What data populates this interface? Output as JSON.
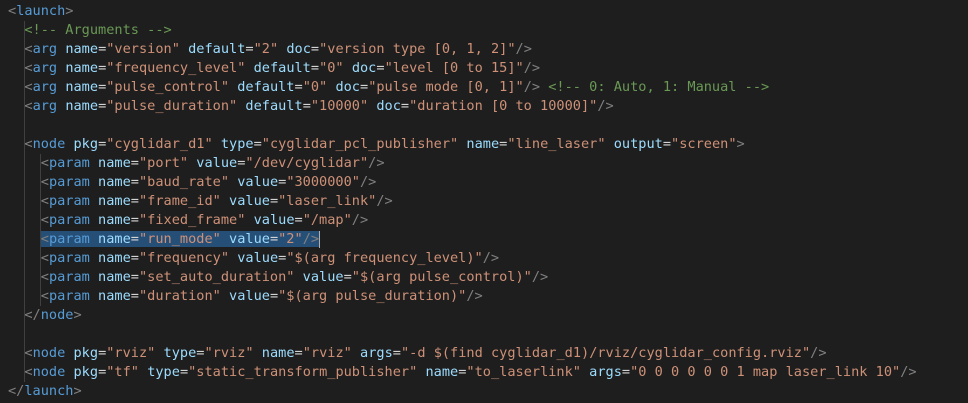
{
  "lines": [
    {
      "indent": 0,
      "tokens": [
        [
          "p",
          "<"
        ],
        [
          "t",
          "launch"
        ],
        [
          "p",
          ">"
        ]
      ]
    },
    {
      "indent": 1,
      "tokens": [
        [
          "c",
          "<!-- Arguments -->"
        ]
      ]
    },
    {
      "indent": 1,
      "tokens": [
        [
          "p",
          "<"
        ],
        [
          "t",
          "arg"
        ],
        [
          "s",
          " "
        ],
        [
          "a",
          "name"
        ],
        [
          "e",
          "="
        ],
        [
          "v",
          "\"version\""
        ],
        [
          "s",
          " "
        ],
        [
          "a",
          "default"
        ],
        [
          "e",
          "="
        ],
        [
          "v",
          "\"2\""
        ],
        [
          "s",
          " "
        ],
        [
          "a",
          "doc"
        ],
        [
          "e",
          "="
        ],
        [
          "v",
          "\"version type [0, 1, 2]\""
        ],
        [
          "p",
          "/>"
        ]
      ]
    },
    {
      "indent": 1,
      "tokens": [
        [
          "p",
          "<"
        ],
        [
          "t",
          "arg"
        ],
        [
          "s",
          " "
        ],
        [
          "a",
          "name"
        ],
        [
          "e",
          "="
        ],
        [
          "v",
          "\"frequency_level\""
        ],
        [
          "s",
          " "
        ],
        [
          "a",
          "default"
        ],
        [
          "e",
          "="
        ],
        [
          "v",
          "\"0\""
        ],
        [
          "s",
          " "
        ],
        [
          "a",
          "doc"
        ],
        [
          "e",
          "="
        ],
        [
          "v",
          "\"level [0 to 15]\""
        ],
        [
          "p",
          "/>"
        ]
      ]
    },
    {
      "indent": 1,
      "tokens": [
        [
          "p",
          "<"
        ],
        [
          "t",
          "arg"
        ],
        [
          "s",
          " "
        ],
        [
          "a",
          "name"
        ],
        [
          "e",
          "="
        ],
        [
          "v",
          "\"pulse_control\""
        ],
        [
          "s",
          " "
        ],
        [
          "a",
          "default"
        ],
        [
          "e",
          "="
        ],
        [
          "v",
          "\"0\""
        ],
        [
          "s",
          " "
        ],
        [
          "a",
          "doc"
        ],
        [
          "e",
          "="
        ],
        [
          "v",
          "\"pulse mode [0, 1]\""
        ],
        [
          "p",
          "/>"
        ],
        [
          "s",
          " "
        ],
        [
          "c",
          "<!-- 0: Auto, 1: Manual -->"
        ]
      ]
    },
    {
      "indent": 1,
      "tokens": [
        [
          "p",
          "<"
        ],
        [
          "t",
          "arg"
        ],
        [
          "s",
          " "
        ],
        [
          "a",
          "name"
        ],
        [
          "e",
          "="
        ],
        [
          "v",
          "\"pulse_duration\""
        ],
        [
          "s",
          " "
        ],
        [
          "a",
          "default"
        ],
        [
          "e",
          "="
        ],
        [
          "v",
          "\"10000\""
        ],
        [
          "s",
          " "
        ],
        [
          "a",
          "doc"
        ],
        [
          "e",
          "="
        ],
        [
          "v",
          "\"duration [0 to 10000]\""
        ],
        [
          "p",
          "/>"
        ]
      ]
    },
    {
      "indent": 1,
      "tokens": []
    },
    {
      "indent": 1,
      "tokens": [
        [
          "p",
          "<"
        ],
        [
          "t",
          "node"
        ],
        [
          "s",
          " "
        ],
        [
          "a",
          "pkg"
        ],
        [
          "e",
          "="
        ],
        [
          "v",
          "\"cyglidar_d1\""
        ],
        [
          "s",
          " "
        ],
        [
          "a",
          "type"
        ],
        [
          "e",
          "="
        ],
        [
          "v",
          "\"cyglidar_pcl_publisher\""
        ],
        [
          "s",
          " "
        ],
        [
          "a",
          "name"
        ],
        [
          "e",
          "="
        ],
        [
          "v",
          "\"line_laser\""
        ],
        [
          "s",
          " "
        ],
        [
          "a",
          "output"
        ],
        [
          "e",
          "="
        ],
        [
          "v",
          "\"screen\""
        ],
        [
          "p",
          ">"
        ]
      ]
    },
    {
      "indent": 2,
      "tokens": [
        [
          "p",
          "<"
        ],
        [
          "t",
          "param"
        ],
        [
          "s",
          " "
        ],
        [
          "a",
          "name"
        ],
        [
          "e",
          "="
        ],
        [
          "v",
          "\"port\""
        ],
        [
          "s",
          " "
        ],
        [
          "a",
          "value"
        ],
        [
          "e",
          "="
        ],
        [
          "v",
          "\"/dev/cyglidar\""
        ],
        [
          "p",
          "/>"
        ]
      ]
    },
    {
      "indent": 2,
      "tokens": [
        [
          "p",
          "<"
        ],
        [
          "t",
          "param"
        ],
        [
          "s",
          " "
        ],
        [
          "a",
          "name"
        ],
        [
          "e",
          "="
        ],
        [
          "v",
          "\"baud_rate\""
        ],
        [
          "s",
          " "
        ],
        [
          "a",
          "value"
        ],
        [
          "e",
          "="
        ],
        [
          "v",
          "\"3000000\""
        ],
        [
          "p",
          "/>"
        ]
      ]
    },
    {
      "indent": 2,
      "tokens": [
        [
          "p",
          "<"
        ],
        [
          "t",
          "param"
        ],
        [
          "s",
          " "
        ],
        [
          "a",
          "name"
        ],
        [
          "e",
          "="
        ],
        [
          "v",
          "\"frame_id\""
        ],
        [
          "s",
          " "
        ],
        [
          "a",
          "value"
        ],
        [
          "e",
          "="
        ],
        [
          "v",
          "\"laser_link\""
        ],
        [
          "p",
          "/>"
        ]
      ]
    },
    {
      "indent": 2,
      "tokens": [
        [
          "p",
          "<"
        ],
        [
          "t",
          "param"
        ],
        [
          "s",
          " "
        ],
        [
          "a",
          "name"
        ],
        [
          "e",
          "="
        ],
        [
          "v",
          "\"fixed_frame\""
        ],
        [
          "s",
          " "
        ],
        [
          "a",
          "value"
        ],
        [
          "e",
          "="
        ],
        [
          "v",
          "\"/map\""
        ],
        [
          "p",
          "/>"
        ]
      ]
    },
    {
      "indent": 2,
      "selected": true,
      "tokens": [
        [
          "p",
          "<"
        ],
        [
          "t",
          "param"
        ],
        [
          "s",
          " "
        ],
        [
          "a",
          "name"
        ],
        [
          "e",
          "="
        ],
        [
          "v",
          "\"run_mode\""
        ],
        [
          "s",
          " "
        ],
        [
          "a",
          "value"
        ],
        [
          "e",
          "="
        ],
        [
          "v",
          "\"2\""
        ],
        [
          "p",
          "/>"
        ]
      ]
    },
    {
      "indent": 2,
      "tokens": [
        [
          "p",
          "<"
        ],
        [
          "t",
          "param"
        ],
        [
          "s",
          " "
        ],
        [
          "a",
          "name"
        ],
        [
          "e",
          "="
        ],
        [
          "v",
          "\"frequency\""
        ],
        [
          "s",
          " "
        ],
        [
          "a",
          "value"
        ],
        [
          "e",
          "="
        ],
        [
          "v",
          "\"$(arg frequency_level)\""
        ],
        [
          "p",
          "/>"
        ]
      ]
    },
    {
      "indent": 2,
      "tokens": [
        [
          "p",
          "<"
        ],
        [
          "t",
          "param"
        ],
        [
          "s",
          " "
        ],
        [
          "a",
          "name"
        ],
        [
          "e",
          "="
        ],
        [
          "v",
          "\"set_auto_duration\""
        ],
        [
          "s",
          " "
        ],
        [
          "a",
          "value"
        ],
        [
          "e",
          "="
        ],
        [
          "v",
          "\"$(arg pulse_control)\""
        ],
        [
          "p",
          "/>"
        ]
      ]
    },
    {
      "indent": 2,
      "tokens": [
        [
          "p",
          "<"
        ],
        [
          "t",
          "param"
        ],
        [
          "s",
          " "
        ],
        [
          "a",
          "name"
        ],
        [
          "e",
          "="
        ],
        [
          "v",
          "\"duration\""
        ],
        [
          "s",
          " "
        ],
        [
          "a",
          "value"
        ],
        [
          "e",
          "="
        ],
        [
          "v",
          "\"$(arg pulse_duration)\""
        ],
        [
          "p",
          "/>"
        ]
      ]
    },
    {
      "indent": 1,
      "tokens": [
        [
          "p",
          "</"
        ],
        [
          "t",
          "node"
        ],
        [
          "p",
          ">"
        ]
      ]
    },
    {
      "indent": 1,
      "tokens": []
    },
    {
      "indent": 1,
      "tokens": [
        [
          "p",
          "<"
        ],
        [
          "t",
          "node"
        ],
        [
          "s",
          " "
        ],
        [
          "a",
          "pkg"
        ],
        [
          "e",
          "="
        ],
        [
          "v",
          "\"rviz\""
        ],
        [
          "s",
          " "
        ],
        [
          "a",
          "type"
        ],
        [
          "e",
          "="
        ],
        [
          "v",
          "\"rviz\""
        ],
        [
          "s",
          " "
        ],
        [
          "a",
          "name"
        ],
        [
          "e",
          "="
        ],
        [
          "v",
          "\"rviz\""
        ],
        [
          "s",
          " "
        ],
        [
          "a",
          "args"
        ],
        [
          "e",
          "="
        ],
        [
          "v",
          "\"-d $(find cyglidar_d1)/rviz/cyglidar_config.rviz\""
        ],
        [
          "p",
          "/>"
        ]
      ]
    },
    {
      "indent": 1,
      "tokens": [
        [
          "p",
          "<"
        ],
        [
          "t",
          "node"
        ],
        [
          "s",
          " "
        ],
        [
          "a",
          "pkg"
        ],
        [
          "e",
          "="
        ],
        [
          "v",
          "\"tf\""
        ],
        [
          "s",
          " "
        ],
        [
          "a",
          "type"
        ],
        [
          "e",
          "="
        ],
        [
          "v",
          "\"static_transform_publisher\""
        ],
        [
          "s",
          " "
        ],
        [
          "a",
          "name"
        ],
        [
          "e",
          "="
        ],
        [
          "v",
          "\"to_laserlink\""
        ],
        [
          "s",
          " "
        ],
        [
          "a",
          "args"
        ],
        [
          "e",
          "="
        ],
        [
          "v",
          "\"0 0 0 0 0 0 1 map laser_link 10\""
        ],
        [
          "p",
          "/>"
        ]
      ]
    },
    {
      "indent": 0,
      "tokens": [
        [
          "p",
          "</"
        ],
        [
          "t",
          "launch"
        ],
        [
          "p",
          ">"
        ]
      ]
    }
  ],
  "colors": {
    "background": "#1e1e1e",
    "tag": "#569cd6",
    "attribute": "#9cdcfe",
    "string": "#ce9178",
    "comment": "#6a9955",
    "punctuation": "#808080",
    "selection": "#264f78"
  }
}
